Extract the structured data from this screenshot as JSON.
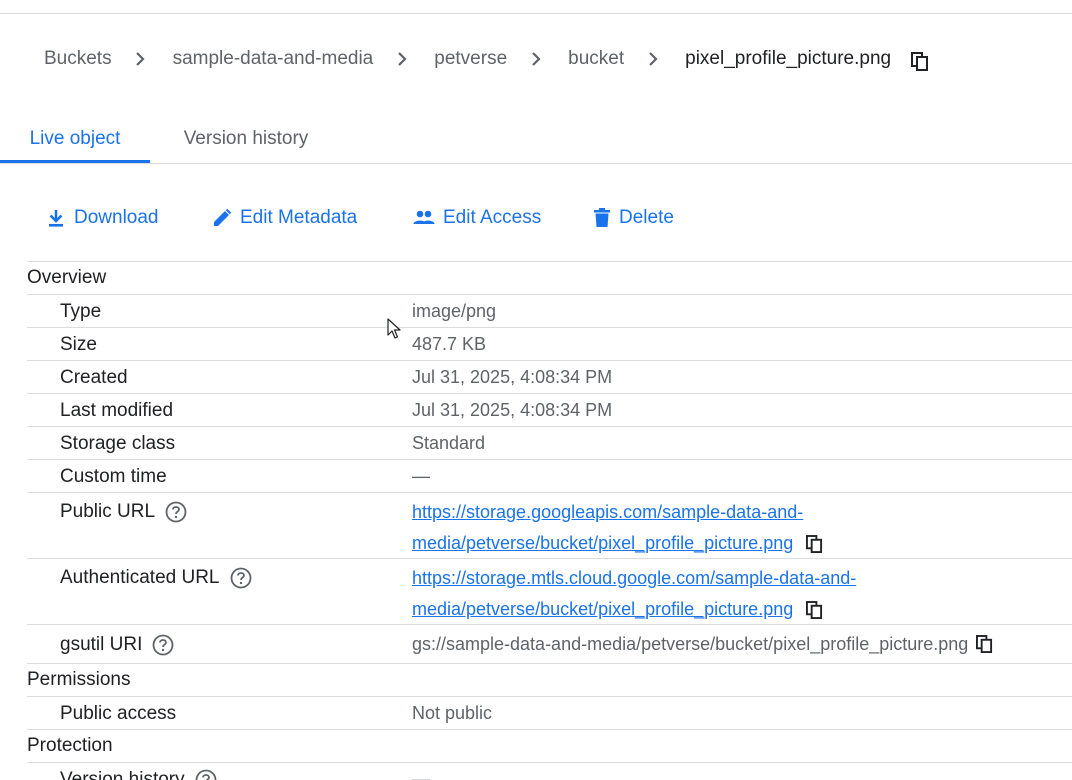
{
  "breadcrumb": {
    "items": [
      "Buckets",
      "sample-data-and-media",
      "petverse",
      "bucket"
    ],
    "current": "pixel_profile_picture.png"
  },
  "tabs": [
    {
      "label": "Live object",
      "active": true
    },
    {
      "label": "Version history",
      "active": false
    }
  ],
  "actions": {
    "download": "Download",
    "edit_metadata": "Edit Metadata",
    "edit_access": "Edit Access",
    "delete": "Delete"
  },
  "sections": {
    "overview": "Overview",
    "permissions": "Permissions",
    "protection": "Protection"
  },
  "overview": {
    "type": {
      "label": "Type",
      "value": "image/png"
    },
    "size": {
      "label": "Size",
      "value": "487.7 KB"
    },
    "created": {
      "label": "Created",
      "value": "Jul 31, 2025, 4:08:34 PM"
    },
    "last_modified": {
      "label": "Last modified",
      "value": "Jul 31, 2025, 4:08:34 PM"
    },
    "storage_class": {
      "label": "Storage class",
      "value": "Standard"
    },
    "custom_time": {
      "label": "Custom time",
      "value": "—"
    },
    "public_url": {
      "label": "Public URL",
      "line1": "https://storage.googleapis.com/sample-data-and-",
      "line2": "media/petverse/bucket/pixel_profile_picture.png"
    },
    "authenticated_url": {
      "label": "Authenticated URL",
      "line1": "https://storage.mtls.cloud.google.com/sample-data-and-",
      "line2": "media/petverse/bucket/pixel_profile_picture.png"
    },
    "gsutil_uri": {
      "label": "gsutil URI",
      "value": "gs://sample-data-and-media/petverse/bucket/pixel_profile_picture.png"
    }
  },
  "permissions": {
    "public_access": {
      "label": "Public access",
      "value": "Not public"
    }
  },
  "protection": {
    "version_history": {
      "label": "Version history",
      "value": "—"
    }
  },
  "colors": {
    "accent": "#1a73e8",
    "text": "#202124",
    "secondary_text": "#5f6368",
    "divider": "#dadce0"
  }
}
